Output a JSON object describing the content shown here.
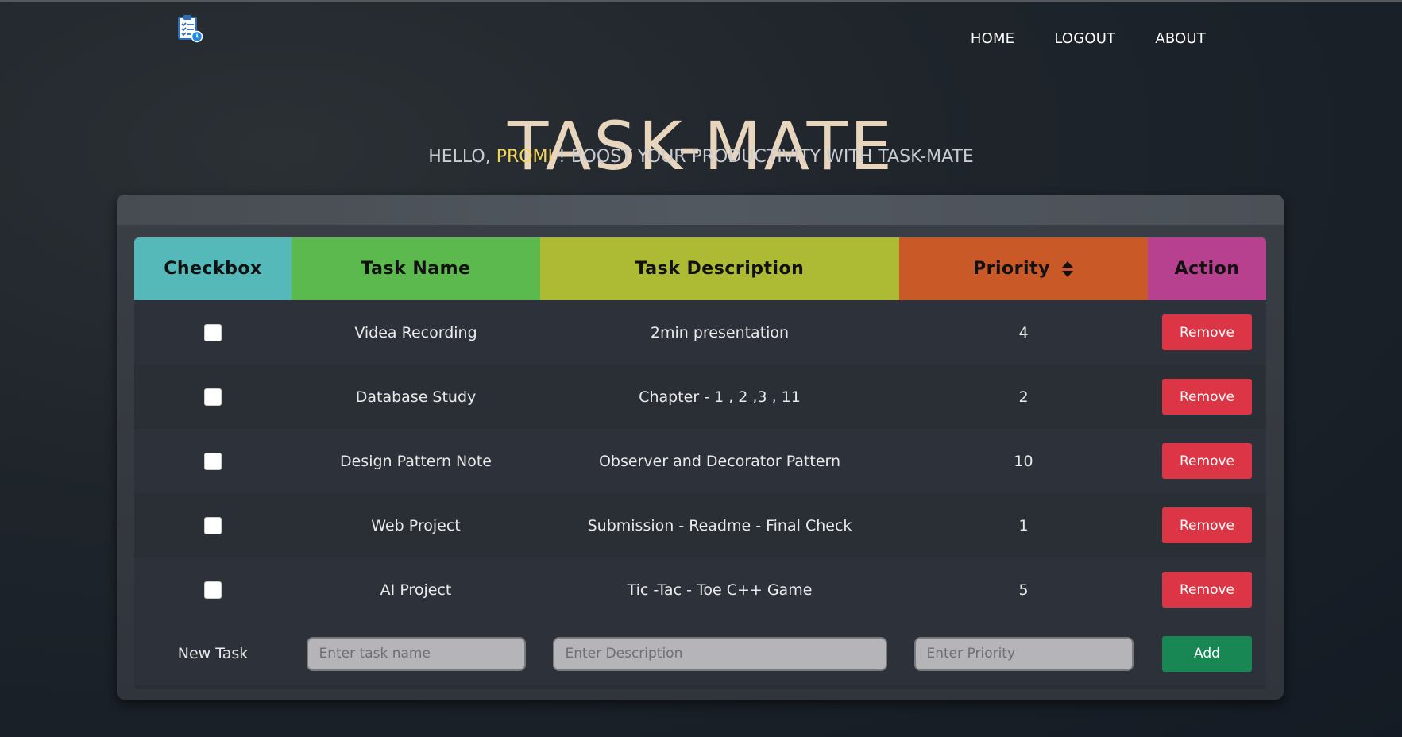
{
  "nav": {
    "home": "HOME",
    "logout": "LOGOUT",
    "about": "ABOUT"
  },
  "logo_icon": "clipboard-checklist-icon",
  "title": "TASK-MATE",
  "subtitle": {
    "prefix": "HELLO, ",
    "user": "PROMI",
    "suffix": " ! BOOST YOUR PRODUCTIVITY WITH TASK-MATE"
  },
  "table": {
    "headers": [
      "Checkbox",
      "Task Name",
      "Task Description",
      "Priority",
      "Action"
    ],
    "header_colors": [
      "#56b9b9",
      "#5bb94e",
      "#adba33",
      "#c95927",
      "#b8418f"
    ],
    "sort_icon": "sort-icon",
    "rows": [
      {
        "name": "Videa Recording",
        "description": "2min presentation",
        "priority": "4",
        "action": "Remove",
        "checked": false
      },
      {
        "name": "Database Study",
        "description": "Chapter - 1 , 2 ,3 , 11",
        "priority": "2",
        "action": "Remove",
        "checked": false
      },
      {
        "name": "Design Pattern Note",
        "description": "Observer and Decorator Pattern",
        "priority": "10",
        "action": "Remove",
        "checked": false
      },
      {
        "name": "Web Project",
        "description": "Submission - Readme - Final Check",
        "priority": "1",
        "action": "Remove",
        "checked": false
      },
      {
        "name": "AI Project",
        "description": "Tic -Tac - Toe C++ Game",
        "priority": "5",
        "action": "Remove",
        "checked": false
      }
    ],
    "new_task": {
      "label": "New Task",
      "name_placeholder": "Enter task name",
      "description_placeholder": "Enter Description",
      "priority_placeholder": "Enter Priority",
      "add_label": "Add"
    }
  },
  "colors": {
    "title": "#e8d5be",
    "user": "#f2d55a",
    "remove": "#dc3545",
    "add": "#198754"
  }
}
